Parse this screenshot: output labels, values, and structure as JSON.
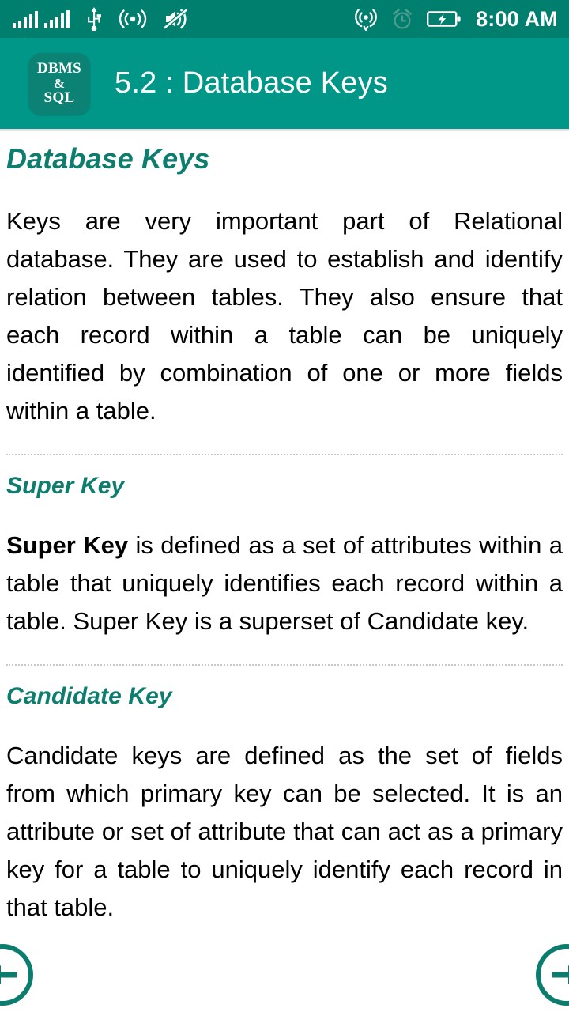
{
  "status_bar": {
    "time": "8:00 AM",
    "icons": [
      {
        "name": "signal-bars-sim1-icon",
        "label": "signal-bars"
      },
      {
        "name": "signal-bars-sim2-icon",
        "label": "signal-bars"
      },
      {
        "name": "usb-icon",
        "label": "usb"
      },
      {
        "name": "wifi-broadcast-icon",
        "label": "wifi"
      },
      {
        "name": "sound-muted-icon",
        "label": "muted"
      },
      {
        "name": "hotspot-icon",
        "label": "hotspot"
      },
      {
        "name": "alarm-clock-icon",
        "label": "alarm"
      },
      {
        "name": "battery-charging-icon",
        "label": "battery-charging"
      }
    ]
  },
  "header": {
    "logo_lines": [
      "DBMS",
      "&",
      "SQL"
    ],
    "title": "5.2 : Database Keys"
  },
  "content": {
    "sections": [
      {
        "heading": "Database Keys",
        "body_lead": "",
        "body": "Keys are very important part of Relational database. They are used to establish and identify relation between tables. They also ensure that each record within a table can be uniquely identified by combination of one or more fields within a table."
      },
      {
        "heading": "Super Key",
        "body_lead": "Super Key",
        "body": " is defined as a set of attributes within a table that uniquely identifies each record within a table. Super Key is a superset of Candidate key."
      },
      {
        "heading": "Candidate Key",
        "body_lead": "",
        "body": "Candidate keys are defined as the set of fields from which primary key can be selected. It is an attribute or set of attribute that can act as a primary key for a table to uniquely identify each record in that table."
      }
    ]
  },
  "navigation": {
    "prev_label": "Previous",
    "next_label": "Next"
  },
  "colors": {
    "status_bar": "#007e6e",
    "app_bar": "#009688",
    "logo_bg": "#0c8274",
    "heading": "#0d7d6e",
    "nav_button": "#0b7d6f",
    "body_text": "#000000",
    "divider": "#c9c9c9"
  }
}
